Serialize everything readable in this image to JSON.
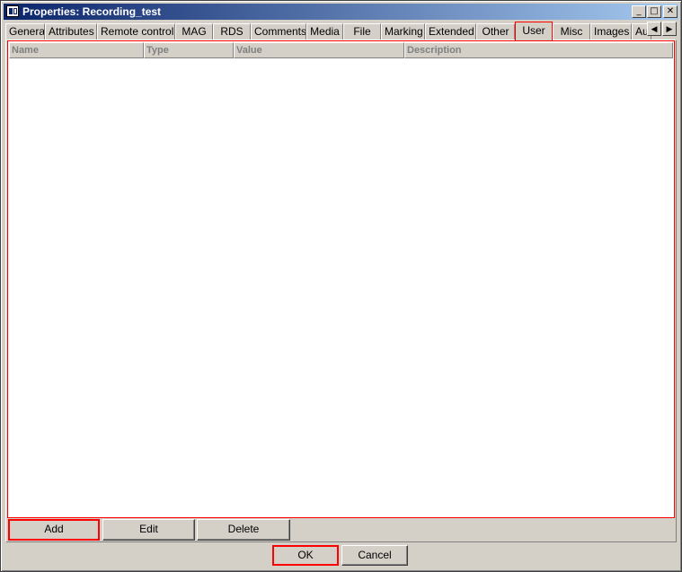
{
  "window": {
    "title": "Properties: Recording_test"
  },
  "titlebar": {
    "min": "_",
    "max": "□",
    "close": "✕"
  },
  "tabs": [
    "General",
    "Attributes",
    "Remote control",
    "MAG",
    "RDS",
    "Comments",
    "Media",
    "File",
    "Marking",
    "Extended",
    "Other",
    "User",
    "Misc",
    "Images",
    "Au"
  ],
  "active_tab": "User",
  "tab_scroll": {
    "left": "◀",
    "right": "▶"
  },
  "columns": [
    "Name",
    "Type",
    "Value",
    "Description"
  ],
  "actions": {
    "add": "Add",
    "edit": "Edit",
    "delete": "Delete"
  },
  "dialog": {
    "ok": "OK",
    "cancel": "Cancel"
  }
}
